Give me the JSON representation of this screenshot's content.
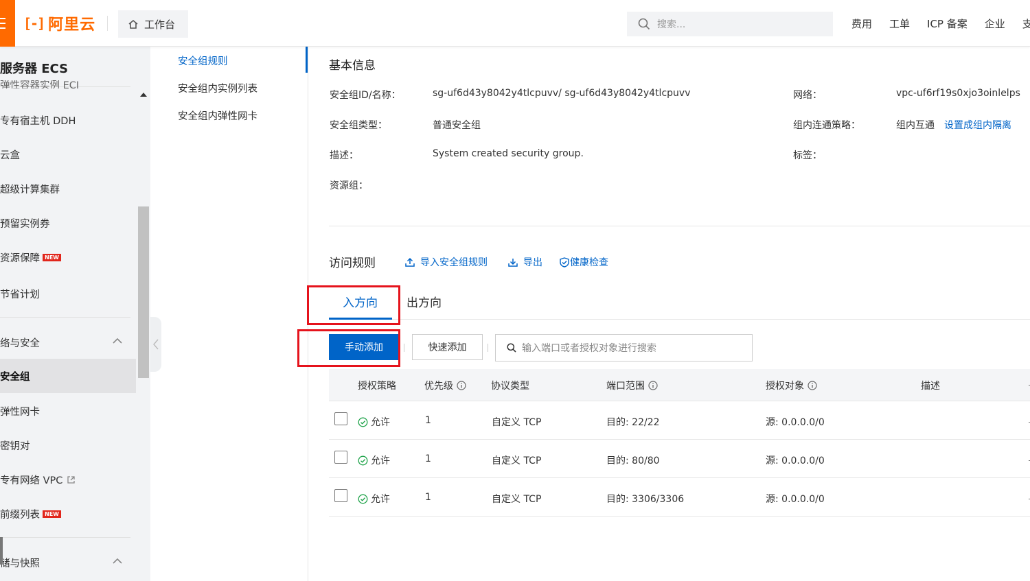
{
  "header": {
    "logo_text": "阿里云",
    "workbench_label": "工作台",
    "search_placeholder": "搜索...",
    "nav": [
      "费用",
      "工单",
      "ICP 备案",
      "企业",
      "支"
    ]
  },
  "sidebar": {
    "title": "服务器 ECS",
    "cut_item": "弹性容器实例 ECI",
    "items": [
      {
        "label": "专有宿主机 DDH"
      },
      {
        "label": "云盒"
      },
      {
        "label": "超级计算集群"
      },
      {
        "label": "预留实例券"
      },
      {
        "label": "资源保障",
        "badge": "NEW"
      },
      {
        "label": "节省计划"
      }
    ],
    "group_network": "络与安全",
    "network_items": [
      {
        "label": "安全组",
        "active": true
      },
      {
        "label": "弹性网卡"
      },
      {
        "label": "密钥对"
      },
      {
        "label": "专有网络 VPC",
        "external": true
      },
      {
        "label": "前缀列表",
        "badge": "NEW"
      }
    ],
    "group_storage": "储与快照"
  },
  "subnav": {
    "items": [
      "安全组规则",
      "安全组内实例列表",
      "安全组内弹性网卡"
    ],
    "active_index": 0
  },
  "basic_info": {
    "title": "基本信息",
    "id_label": "安全组ID/名称：",
    "id_value": "sg-uf6d43y8042y4tlcpuvv/ sg-uf6d43y8042y4tlcpuvv",
    "network_label": "网络：",
    "network_value": "vpc-uf6rf19s0xjo3oinlelps",
    "type_label": "安全组类型：",
    "type_value": "普通安全组",
    "policy_label": "组内连通策略：",
    "policy_value": "组内互通",
    "policy_link": "设置成组内隔离",
    "desc_label": "描述：",
    "desc_value": "System created security group.",
    "tag_label": "标签：",
    "rg_label": "资源组："
  },
  "rules": {
    "title": "访问规则",
    "actions": [
      "导入安全组规则",
      "导出",
      "健康检查"
    ],
    "tabs": [
      "入方向",
      "出方向"
    ],
    "active_tab": 0,
    "manual_add": "手动添加",
    "quick_add": "快速添加",
    "search_placeholder": "输入端口或者授权对象进行搜索",
    "columns": [
      "授权策略",
      "优先级",
      "协议类型",
      "端口范围",
      "授权对象",
      "描述"
    ],
    "rows": [
      {
        "policy": "允许",
        "priority": "1",
        "protocol": "自定义 TCP",
        "port": "目的: 22/22",
        "source": "源: 0.0.0.0/0",
        "desc": ""
      },
      {
        "policy": "允许",
        "priority": "1",
        "protocol": "自定义 TCP",
        "port": "目的: 80/80",
        "source": "源: 0.0.0.0/0",
        "desc": ""
      },
      {
        "policy": "允许",
        "priority": "1",
        "protocol": "自定义 TCP",
        "port": "目的: 3306/3306",
        "source": "源: 0.0.0.0/0",
        "desc": ""
      }
    ]
  },
  "colors": {
    "brand": "#ff6a00",
    "primary": "#0064c8",
    "highlight": "#e5131c",
    "success": "#1fa34a",
    "new_badge": "#e1251b"
  },
  "icons": {
    "menu": "hamburger-icon",
    "workbench": "home-icon",
    "search": "search-icon",
    "import": "upload-icon",
    "export": "download-icon",
    "health": "shield-check-icon",
    "info": "info-circle-icon",
    "allow": "check-circle-icon"
  }
}
